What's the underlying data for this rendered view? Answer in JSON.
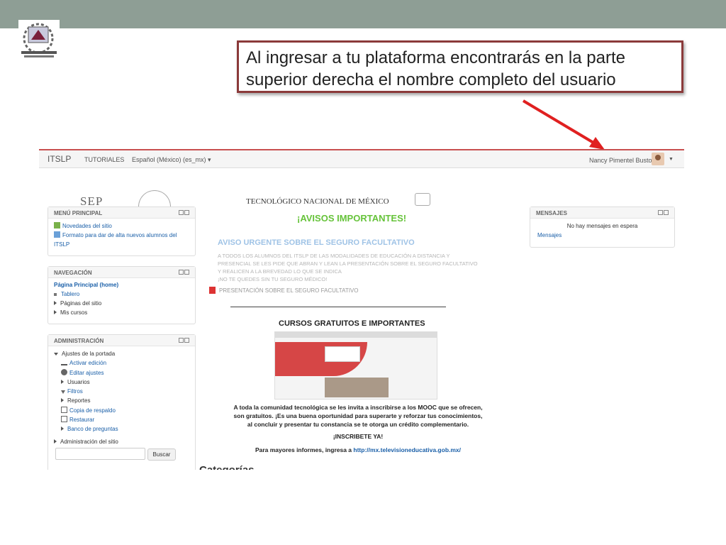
{
  "callout": {
    "text": "Al ingresar a tu plataforma encontrarás en la parte superior derecha el nombre completo del usuario"
  },
  "navbar": {
    "brand": "ITSLP",
    "tutorials": "TUTORIALES",
    "language": "Español (México) (es_mx)",
    "user": "Nancy Pimentel Bustos"
  },
  "header": {
    "sep": "SEP",
    "tec": "TECNOLÓGICO NACIONAL DE MÉXICO"
  },
  "menu_principal": {
    "title": "MENÚ PRINCIPAL",
    "items": [
      "Novedades del sitio",
      "Formato para dar de alta nuevos alumnos del ITSLP"
    ]
  },
  "navegacion": {
    "title": "NAVEGACIÓN",
    "home": "Página Principal (home)",
    "items": [
      "Tablero",
      "Páginas del sitio",
      "Mis cursos"
    ]
  },
  "administracion": {
    "title": "ADMINISTRACIÓN",
    "portada": "Ajustes de la portada",
    "items": [
      "Activar edición",
      "Editar ajustes",
      "Usuarios",
      "Filtros",
      "Reportes",
      "Copia de respaldo",
      "Restaurar",
      "Banco de preguntas"
    ],
    "site_admin": "Administración del sitio",
    "search_button": "Buscar"
  },
  "mensajes": {
    "title": "MENSAJES",
    "empty": "No hay mensajes en espera",
    "link": "Mensajes"
  },
  "main": {
    "avisos": "¡AVISOS IMPORTANTES!",
    "aviso_title": "AVISO URGENTE SOBRE EL SEGURO FACULTATIVO",
    "aviso_lines": [
      "A TODOS LOS ALUMNOS DEL ITSLP DE LAS MODALIDADES DE EDUCACIÓN A DISTANCIA Y",
      "PRESENCIAL SE LES PIDE QUE ABRAN Y LEAN LA PRESENTACIÓN SOBRE EL SEGURO FACULTATIVO",
      "Y REALICEN A LA BREVEDAD LO QUE SE INDICA",
      "¡NO TE QUEDES SIN TU SEGURO MÉDICO!"
    ],
    "presentacion": "PRESENTACIÓN SOBRE EL SEGURO FACULTATIVO",
    "cursos": "CURSOS GRATUITOS E IMPORTANTES",
    "msg_lines": [
      "A toda la comunidad tecnológica se les invita a inscribirse a los MOOC que se ofrecen,",
      "son gratuitos. ¡Es una buena oportunidad para superarte y reforzar tus conocimientos,",
      "al concluir y presentar tu constancia se te otorga un crédito complementario."
    ],
    "inscribete": "¡INSCRIBETE YA!",
    "info_prefix": "Para mayores informes, ingresa a",
    "info_link": "http://mx.televisioneducativa.gob.mx/",
    "categorias": "Categorías"
  }
}
